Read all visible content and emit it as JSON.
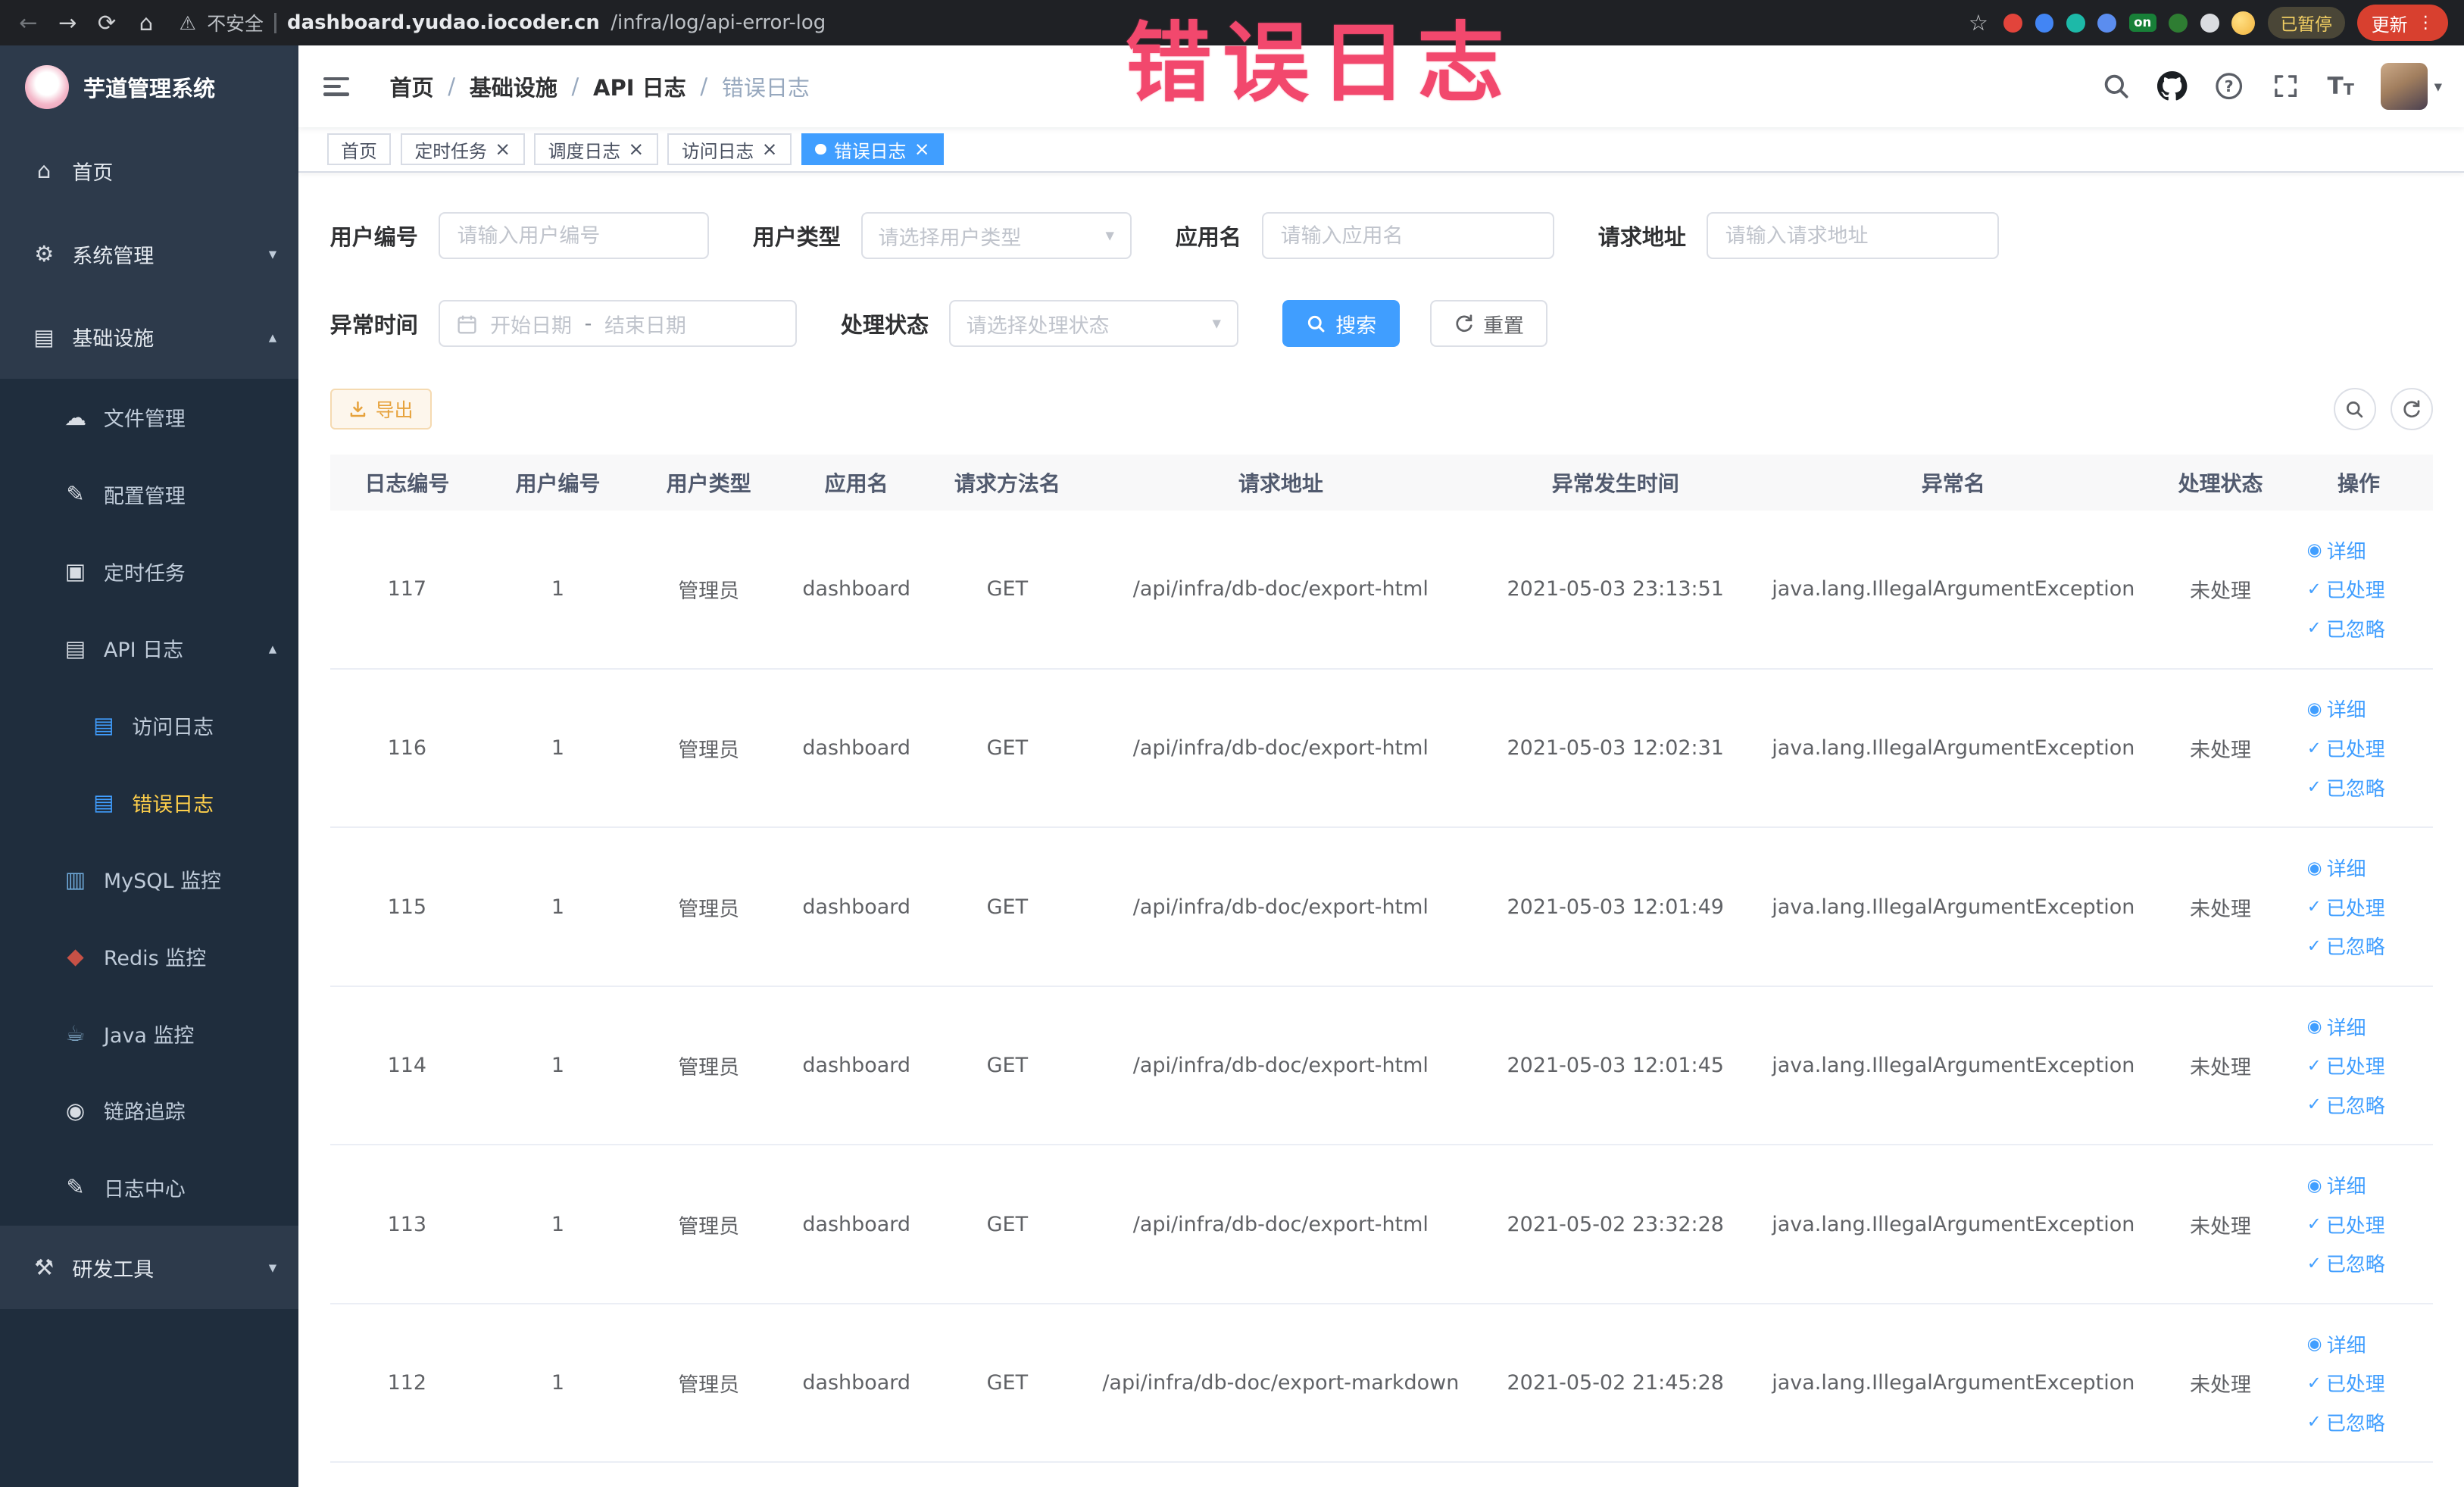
{
  "annotation": {
    "text": "错误日志",
    "color": "#f2486d"
  },
  "browser": {
    "security_label": "不安全",
    "url_domain": "dashboard.yudao.iocoder.cn",
    "url_path": "/infra/log/api-error-log",
    "on_badge": "on",
    "paused_badge": "已暂停",
    "update_button": "更新"
  },
  "app": {
    "logo_title": "芋道管理系统"
  },
  "sidebar": {
    "items": [
      {
        "label": "首页"
      },
      {
        "label": "系统管理"
      },
      {
        "label": "基础设施"
      },
      {
        "label": "文件管理"
      },
      {
        "label": "配置管理"
      },
      {
        "label": "定时任务"
      },
      {
        "label": "API 日志"
      },
      {
        "label": "访问日志"
      },
      {
        "label": "错误日志"
      },
      {
        "label": "MySQL 监控"
      },
      {
        "label": "Redis 监控"
      },
      {
        "label": "Java 监控"
      },
      {
        "label": "链路追踪"
      },
      {
        "label": "日志中心"
      },
      {
        "label": "研发工具"
      }
    ]
  },
  "breadcrumb": {
    "separator": "/",
    "items": [
      "首页",
      "基础设施",
      "API 日志",
      "错误日志"
    ]
  },
  "tabs": [
    {
      "label": "首页"
    },
    {
      "label": "定时任务"
    },
    {
      "label": "调度日志"
    },
    {
      "label": "访问日志"
    },
    {
      "label": "错误日志"
    }
  ],
  "filters": {
    "user_id": {
      "label": "用户编号",
      "placeholder": "请输入用户编号"
    },
    "user_type": {
      "label": "用户类型",
      "placeholder": "请选择用户类型"
    },
    "app_name": {
      "label": "应用名",
      "placeholder": "请输入应用名"
    },
    "request_url": {
      "label": "请求地址",
      "placeholder": "请输入请求地址"
    },
    "exception_time": {
      "label": "异常时间",
      "start_placeholder": "开始日期",
      "separator": "-",
      "end_placeholder": "结束日期"
    },
    "process_status": {
      "label": "处理状态",
      "placeholder": "请选择处理状态"
    },
    "search_button": "搜索",
    "reset_button": "重置"
  },
  "toolbar": {
    "export_button": "导出"
  },
  "table": {
    "columns": [
      "日志编号",
      "用户编号",
      "用户类型",
      "应用名",
      "请求方法名",
      "请求地址",
      "异常发生时间",
      "异常名",
      "处理状态",
      "操作"
    ],
    "actions": {
      "detail": "详细",
      "process": "已处理",
      "ignore": "已忽略"
    },
    "rows": [
      {
        "id": "117",
        "user_id": "1",
        "user_type": "管理员",
        "app": "dashboard",
        "method": "GET",
        "url": "/api/infra/db-doc/export-html",
        "time": "2021-05-03 23:13:51",
        "exception": "java.lang.IllegalArgumentException",
        "status": "未处理"
      },
      {
        "id": "116",
        "user_id": "1",
        "user_type": "管理员",
        "app": "dashboard",
        "method": "GET",
        "url": "/api/infra/db-doc/export-html",
        "time": "2021-05-03 12:02:31",
        "exception": "java.lang.IllegalArgumentException",
        "status": "未处理"
      },
      {
        "id": "115",
        "user_id": "1",
        "user_type": "管理员",
        "app": "dashboard",
        "method": "GET",
        "url": "/api/infra/db-doc/export-html",
        "time": "2021-05-03 12:01:49",
        "exception": "java.lang.IllegalArgumentException",
        "status": "未处理"
      },
      {
        "id": "114",
        "user_id": "1",
        "user_type": "管理员",
        "app": "dashboard",
        "method": "GET",
        "url": "/api/infra/db-doc/export-html",
        "time": "2021-05-03 12:01:45",
        "exception": "java.lang.IllegalArgumentException",
        "status": "未处理"
      },
      {
        "id": "113",
        "user_id": "1",
        "user_type": "管理员",
        "app": "dashboard",
        "method": "GET",
        "url": "/api/infra/db-doc/export-html",
        "time": "2021-05-02 23:32:28",
        "exception": "java.lang.IllegalArgumentException",
        "status": "未处理"
      },
      {
        "id": "112",
        "user_id": "1",
        "user_type": "管理员",
        "app": "dashboard",
        "method": "GET",
        "url": "/api/infra/db-doc/export-markdown",
        "time": "2021-05-02 21:45:28",
        "exception": "java.lang.IllegalArgumentException",
        "status": "未处理"
      }
    ]
  },
  "icons": {
    "back": "←",
    "forward": "→",
    "reload": "⟳",
    "home": "⌂",
    "warning": "⚠",
    "star": "☆",
    "kebab": "⋮",
    "close": "×",
    "chevron-down": "▾",
    "chevron-up": "▴",
    "caret-down": "▾",
    "question": "?",
    "menu-home": "⌂",
    "menu-gear": "⚙",
    "menu-infra": "▤",
    "menu-cloud": "☁",
    "menu-edit": "✎",
    "menu-task": "▣",
    "menu-api": "▤",
    "menu-doc": "▤",
    "menu-mysql": "▥",
    "menu-redis": "◆",
    "menu-java": "☕",
    "menu-eye": "◉",
    "menu-log": "✎",
    "menu-tools": "⚒",
    "view": "◉",
    "check": "✓",
    "font-size": "T"
  },
  "colors": {
    "primary": "#409eff",
    "sidebar_bg": "#2d3a4b",
    "submenu_bg": "#1f2d3d",
    "active_menu_text": "#ffd04b",
    "warning": "#e6a23c",
    "update_button_bg": "#d8402f",
    "annotation": "#f2486d"
  }
}
